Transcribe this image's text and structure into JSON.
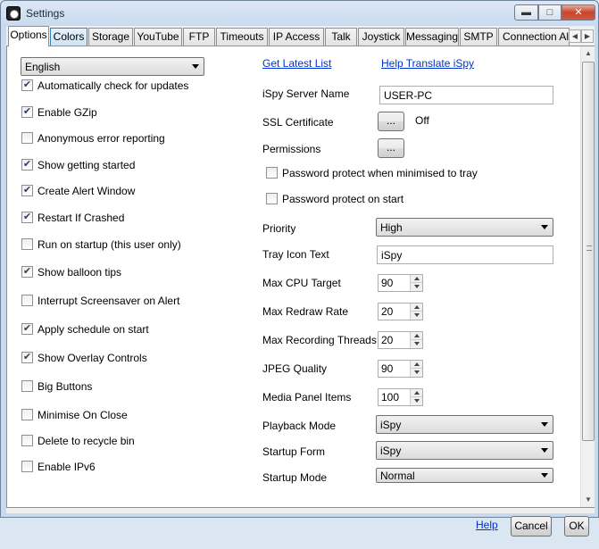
{
  "window": {
    "title": "Settings",
    "minimize_icon": "minimize-icon",
    "maximize_icon": "maximize-icon",
    "close_icon": "close-icon"
  },
  "tabs": [
    "Options",
    "Colors",
    "Storage",
    "YouTube",
    "FTP",
    "Timeouts",
    "IP Access",
    "Talk",
    "Joystick",
    "Messaging",
    "SMTP",
    "Connection Alerts"
  ],
  "language": {
    "value": "English"
  },
  "links": {
    "get_latest": "Get Latest List",
    "help_translate": "Help Translate iSpy"
  },
  "left_options": [
    {
      "label": "Automatically check for updates",
      "checked": true
    },
    {
      "label": "Enable GZip",
      "checked": true
    },
    {
      "label": "Anonymous error reporting",
      "checked": false
    },
    {
      "label": "Show getting started",
      "checked": true
    },
    {
      "label": "Create Alert Window",
      "checked": true
    },
    {
      "label": "Restart If Crashed",
      "checked": true
    },
    {
      "label": "Run on startup (this user only)",
      "checked": false
    },
    {
      "label": "Show balloon tips",
      "checked": true
    },
    {
      "label": "Interrupt Screensaver on Alert",
      "checked": false
    },
    {
      "label": "Apply schedule on start",
      "checked": true
    },
    {
      "label": "Show Overlay Controls",
      "checked": true
    },
    {
      "label": "Big Buttons",
      "checked": false
    },
    {
      "label": "Minimise On Close",
      "checked": false
    },
    {
      "label": "Delete to recycle bin",
      "checked": false
    },
    {
      "label": "Enable IPv6",
      "checked": false
    }
  ],
  "right": {
    "server_name_label": "iSpy Server Name",
    "server_name_value": "USER-PC",
    "ssl_label": "SSL Certificate",
    "ssl_button": "...",
    "ssl_status": "Off",
    "permissions_label": "Permissions",
    "permissions_button": "...",
    "pw_minimised_label": "Password protect when minimised to tray",
    "pw_minimised_checked": false,
    "pw_start_label": "Password protect on start",
    "pw_start_checked": false,
    "priority_label": "Priority",
    "priority_value": "High",
    "tray_label": "Tray Icon Text",
    "tray_value": "iSpy",
    "cpu_label": "Max CPU Target",
    "cpu_value": "90",
    "redraw_label": "Max Redraw Rate",
    "redraw_value": "20",
    "threads_label": "Max Recording Threads",
    "threads_value": "20",
    "jpeg_label": "JPEG Quality",
    "jpeg_value": "90",
    "media_label": "Media Panel Items",
    "media_value": "100",
    "playback_label": "Playback Mode",
    "playback_value": "iSpy",
    "startup_form_label": "Startup Form",
    "startup_form_value": "iSpy",
    "startup_mode_label": "Startup Mode",
    "startup_mode_value": "Normal"
  },
  "footer": {
    "help": "Help",
    "cancel": "Cancel",
    "ok": "OK"
  }
}
